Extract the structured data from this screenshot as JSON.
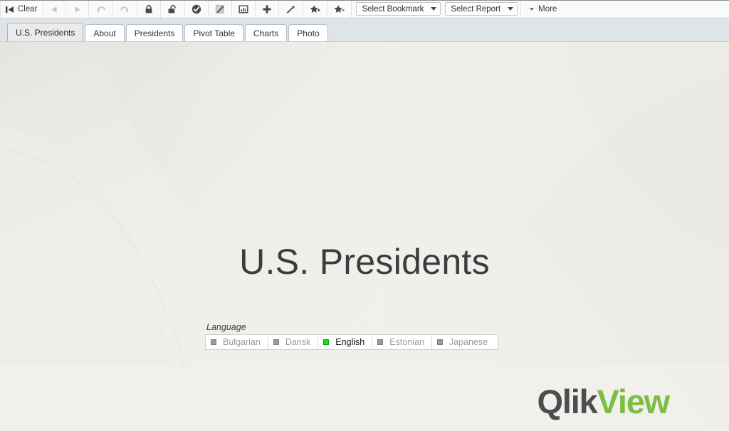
{
  "toolbar": {
    "clear_label": "Clear",
    "buttons": [
      {
        "name": "clear-button",
        "icon": "skip-back-icon",
        "label": "Clear",
        "enabled": true
      },
      {
        "name": "back-button",
        "icon": "triangle-left-icon",
        "label": "",
        "enabled": false
      },
      {
        "name": "forward-button",
        "icon": "triangle-right-icon",
        "label": "",
        "enabled": false
      },
      {
        "name": "undo-button",
        "icon": "undo-arrow-icon",
        "label": "",
        "enabled": false
      },
      {
        "name": "redo-button",
        "icon": "redo-arrow-icon",
        "label": "",
        "enabled": false
      },
      {
        "name": "lock-button",
        "icon": "lock-closed-icon",
        "label": "",
        "enabled": true
      },
      {
        "name": "unlock-button",
        "icon": "lock-open-icon",
        "label": "",
        "enabled": true
      },
      {
        "name": "apply-button",
        "icon": "check-circle-icon",
        "label": "",
        "enabled": true
      },
      {
        "name": "edit-button",
        "icon": "pencil-edit-icon",
        "label": "",
        "enabled": true
      },
      {
        "name": "chart-button",
        "icon": "bar-chart-icon",
        "label": "",
        "enabled": true
      },
      {
        "name": "add-button",
        "icon": "plus-icon",
        "label": "",
        "enabled": true
      },
      {
        "name": "clear-field-button",
        "icon": "eraser-wand-icon",
        "label": "",
        "enabled": true
      },
      {
        "name": "add-bookmark-button",
        "icon": "star-plus-icon",
        "label": "",
        "enabled": true
      },
      {
        "name": "remove-bookmark-button",
        "icon": "star-minus-icon",
        "label": "",
        "enabled": true
      }
    ],
    "select_bookmark": "Select Bookmark",
    "select_report": "Select Report",
    "more_label": "More"
  },
  "tabs": [
    {
      "label": "U.S. Presidents",
      "active": true
    },
    {
      "label": "About",
      "active": false
    },
    {
      "label": "Presidents",
      "active": false
    },
    {
      "label": "Pivot Table",
      "active": false
    },
    {
      "label": "Charts",
      "active": false
    },
    {
      "label": "Photo",
      "active": false
    }
  ],
  "sheet": {
    "title": "U.S. Presidents"
  },
  "listbox": {
    "caption": "Language",
    "items": [
      {
        "label": "Bulgarian",
        "selected": false
      },
      {
        "label": "Dansk",
        "selected": false
      },
      {
        "label": "English",
        "selected": true
      },
      {
        "label": "Estonian",
        "selected": false
      },
      {
        "label": "Japanese",
        "selected": false
      }
    ]
  },
  "logo": {
    "part1": "Qlik",
    "part2": "View"
  },
  "colors": {
    "selection_green": "#14e014",
    "logo_green": "#7bbf3f",
    "logo_gray": "#4d4d4d",
    "tabstrip_bg": "#dfe4e8",
    "sheet_bg": "#efedea",
    "title_text": "#3c3c3c"
  }
}
